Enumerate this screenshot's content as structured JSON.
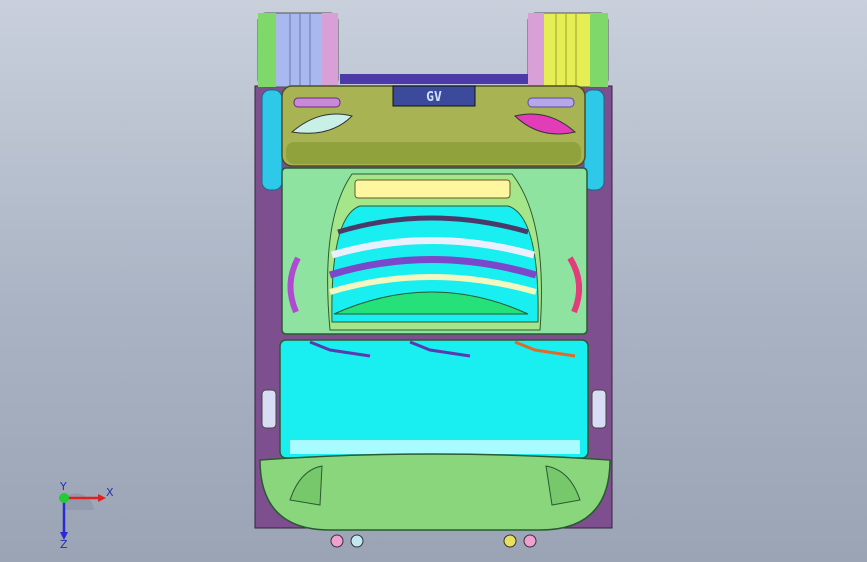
{
  "viewport": {
    "title": "",
    "background_top": "#c9d0dc",
    "background_bottom": "#9aa4b4"
  },
  "model": {
    "plate_text": "GV",
    "colors": {
      "chassis": "#7e4f8e",
      "cab_body": "#8fe3a0",
      "roof": "#a6e68a",
      "hood": "#a8b454",
      "windshield": "#19eef0",
      "bumper": "#8ad67d",
      "tire_left": "#a9b8ef",
      "tire_right": "#e5ee55",
      "accent_pink": "#e23cb8"
    }
  },
  "triad": {
    "x_label": "X",
    "y_label": "Y",
    "z_label": "Z"
  }
}
